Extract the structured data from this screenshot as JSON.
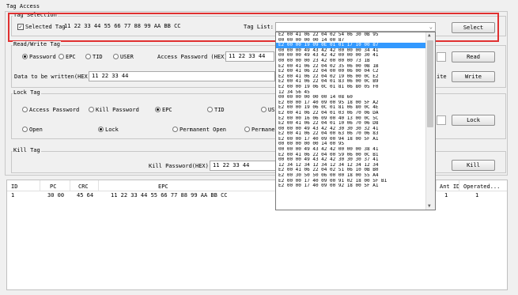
{
  "section_title": "Tag Access",
  "tag_selection": {
    "group_title": "Tag Selection",
    "selected_checkbox_label": "Selected Tag",
    "selected_checked": true,
    "selected_tag_value": "11 22 33 44 55 66 77 88 99 AA BB CC",
    "tag_list_label": "Tag List:",
    "select_button": "Select"
  },
  "read_write": {
    "group_title": "Read/Write Tag",
    "bank_options": [
      "Password",
      "EPC",
      "TID",
      "USER"
    ],
    "bank_selected": "Password",
    "access_password_label": "Access Password (HEX) :",
    "access_password_value": "11 22 33 44",
    "read_button": "Read",
    "data_label": "Data to be written(HEX):",
    "data_value": "11 22 33 44",
    "write_label_partial": "ite",
    "write_button": "Write"
  },
  "lock_tag": {
    "group_title": "Lock Tag",
    "area_options": [
      "Access Password",
      "Kill Password",
      "EPC",
      "TID",
      "USE"
    ],
    "area_selected": "EPC",
    "action_options": [
      "Open",
      "Lock",
      "Permanent Open",
      "Permanent"
    ],
    "action_selected": "Lock",
    "lock_button": "Lock"
  },
  "kill_tag": {
    "group_title": "Kill Tag",
    "kill_password_label": "Kill Password(HEX):",
    "kill_password_value": "11 22 33 44",
    "kill_button": "Kill"
  },
  "table": {
    "headers": [
      "ID",
      "PC",
      "CRC",
      "EPC",
      "Ant ID",
      "Operated..."
    ],
    "rows": [
      {
        "id": "1",
        "pc": "30 00",
        "crc": "45 64",
        "epc": "11 22 33 44 55 66 77 88 99 AA BB CC",
        "ant": "1",
        "operated": "1"
      }
    ]
  },
  "tag_list": {
    "selected_value": "",
    "selected_index": 2,
    "items": [
      "E2 00 41 06 22 04 02 54 06 30 0B 95",
      "00 00 00 00 00 14 00 87",
      "E2 00 00 19 09 0E 01 01 17 10 00 87",
      "00 00 00 49 43 42 42 00 00 00 34 41",
      "00 00 00 49 43 42 42 00 00 00 30 41",
      "00 00 00 00 23 42 00 00 00 73 1B",
      "E2 00 41 06 22 04 02 35 06 00 0B 1B",
      "E2 00 41 06 22 04 00 00 06 00 04 C2",
      "E2 00 41 06 22 04 02 19 06 00 0C E2",
      "E2 00 41 06 22 04 01 83 06 00 0C B9",
      "E2 00 00 19 06 0C 01 81 06 80 05 F0",
      "12 34 56 45",
      "00 00 00 00 00 00 14 08 60",
      "E2 00 00 17 40 09 00 95 18 00 5F A2",
      "E2 00 00 19 06 0C 01 81 06 80 0C 4E",
      "E2 00 41 06 22 04 01 03 06 70 06 DA",
      "E2 00 00 16 06 09 00 40 13 00 0C 5C",
      "E2 00 41 06 22 04 01 10 06 70 06 D8",
      "00 00 00 49 43 42 42 30 30 30 32 41",
      "E2 00 41 06 22 04 00 63 06 70 06 83",
      "E2 00 00 17 40 09 00 94 18 00 5F A1",
      "00 00 00 00 00 14 00 95",
      "00 00 00 49 43 42 42 00 00 00 38 41",
      "E2 00 41 06 22 04 00 59 06 00 0C B1",
      "00 00 00 49 43 42 42 30 30 30 37 41",
      "12 34 12 34 12 34 12 34 12 34 12 34",
      "E2 00 41 06 22 04 02 51 06 10 0B B0",
      "E2 00 30 50 50 06 00 00 18 00 55 A4",
      "E2 00 00 17 40 09 00 91 02 18 00 5F B1",
      "E2 00 00 17 40 09 00 92 18 00 5F A1"
    ]
  }
}
